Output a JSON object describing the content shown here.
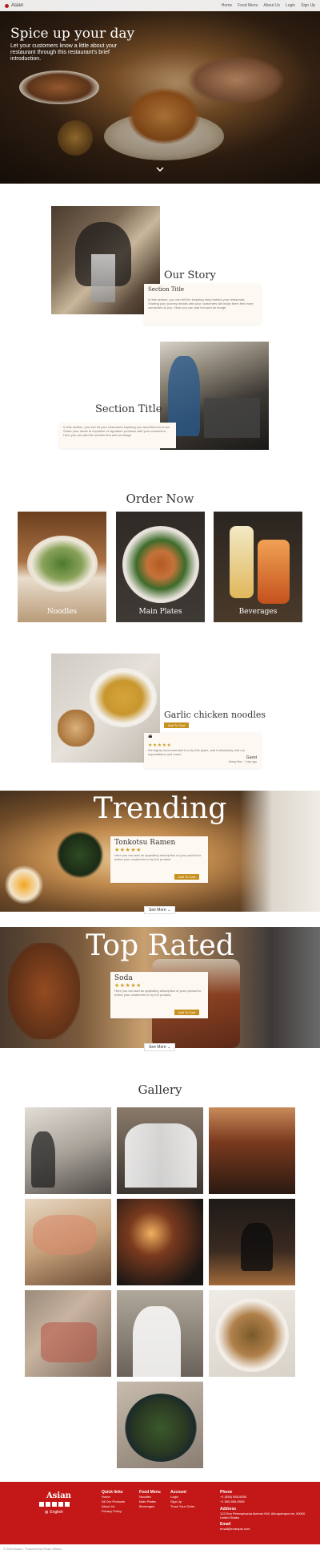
{
  "nav": {
    "brand": "Asian",
    "links": [
      "Home",
      "Food Menu",
      "About Us",
      "Login",
      "Sign Up"
    ]
  },
  "hero": {
    "title": "Spice up your day",
    "subtitle": "Let your customers know a little about your restaurant through this restaurant's brief introduction.",
    "chevron_icon": "chevron-down-icon"
  },
  "story": {
    "heading": "Our Story",
    "card1_title": "Section Title",
    "card1_text": "In this section, you can tell the inspiring story behind your restaurant. Sharing your journey details with your customers will make them feel more connected to you. Here you can add text and an image.",
    "section2_title": "Section Title",
    "section2_text": "In this section, you can let your customers anything you want them to know. Share your areas of expertise or signature products with your customers. Here you can add the section text and an image."
  },
  "order": {
    "heading": "Order Now",
    "items": [
      "Noodles",
      "Main Plates",
      "Beverages"
    ]
  },
  "featured": {
    "title": "Garlic chicken noodles",
    "button": "Add To Cart",
    "quote_icon": "quote-icon",
    "stars": "★★★★★",
    "review": "We highly recommended it to try this place, and it absolutely met our expectations and more!",
    "reviewer": "Guest",
    "review_date": "Jimmy Bae · 1 day ago"
  },
  "trending": {
    "title": "Trending",
    "item_name": "Tonkotsu Ramen",
    "stars": "★★★★★",
    "description": "Here you can add an appealing description of your product to entice your customers to try the product.",
    "button": "Add To Cart",
    "see_more": "See More"
  },
  "top_rated": {
    "title": "Top Rated",
    "item_name": "Soda",
    "stars": "★★★★★",
    "description": "Here you can add an appealing description of your product to entice your customers to try the product.",
    "button": "Add To Cart",
    "see_more": "See More"
  },
  "gallery": {
    "heading": "Gallery"
  },
  "footer": {
    "brand": "Asian",
    "language": "English",
    "quick_links_head": "Quick links",
    "quick_links": [
      "Home",
      "All Our Products",
      "About Us",
      "Privacy Policy"
    ],
    "food_menu_head": "Food Menu",
    "food_menu": [
      "Noodles",
      "Main Plates",
      "Beverages"
    ],
    "account_head": "Account",
    "account": [
      "Login",
      "Sign Up",
      "Track Your Order"
    ],
    "phone_head": "Phone",
    "phones": [
      "+1 (555) 555-5555",
      "+1 555-555-5555"
    ],
    "address_head": "Address",
    "address": "123 Sun Pennsylvania Avenue NW, Albuquerque,ms, 00000 United States",
    "email_head": "Email",
    "email": "email@example.com",
    "copyright": "© 2024 Asian · Powered By Rosie Wilson"
  },
  "colors": {
    "accent": "#c79220",
    "footer": "#c41818",
    "card_bg": "#fdf8f2"
  }
}
